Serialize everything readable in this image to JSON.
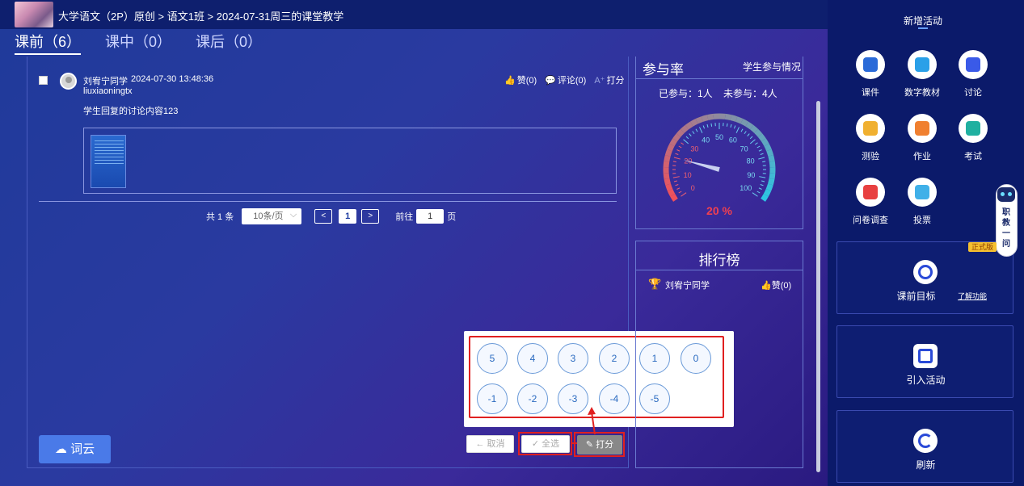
{
  "breadcrumb": {
    "text": "大学语文（2P）原创 > 语文1班 > 2024-07-31周三的课堂教学"
  },
  "tabs": [
    {
      "label": "课前（6）"
    },
    {
      "label": "课中（0）"
    },
    {
      "label": "课后（0）"
    }
  ],
  "post": {
    "name": "刘宥宁同学",
    "time": "2024-07-30 13:48:36",
    "userid": "liuxiaoningtx",
    "content": "学生回复的讨论内容123",
    "like": "赞(0)",
    "comment": "评论(0)",
    "score": "打分"
  },
  "pager": {
    "total": "共 1 条",
    "pagesize": "10条/页",
    "prev": "<",
    "current": "1",
    "next": ">",
    "goto_label": "前往",
    "goto_value": "1",
    "goto_unit": "页"
  },
  "wordcloud_label": "词云",
  "score_popup": {
    "row1": [
      "5",
      "4",
      "3",
      "2",
      "1",
      "0"
    ],
    "row2": [
      "-1",
      "-2",
      "-3",
      "-4",
      "-5"
    ]
  },
  "bottom_buttons": {
    "cancel": "取消",
    "select_all": "全选",
    "score": "打分"
  },
  "participation": {
    "title": "参与率",
    "link": "学生参与情况",
    "stats": "已参与：1人    未参与：4人",
    "percent_label": "20 %",
    "percent": 20,
    "ticks": [
      "0",
      "10",
      "20",
      "30",
      "40",
      "50",
      "60",
      "70",
      "80",
      "90",
      "100"
    ]
  },
  "ranking": {
    "title": "排行榜",
    "items": [
      {
        "name": "刘宥宁同学",
        "likes": "赞(0)"
      }
    ]
  },
  "sidebar": {
    "title": "新增活动",
    "activities": [
      {
        "label": "课件",
        "color": "#2a6ad8"
      },
      {
        "label": "数字教材",
        "color": "#2aa0e8"
      },
      {
        "label": "讨论",
        "color": "#3a5ae8"
      },
      {
        "label": "测验",
        "color": "#f0b030"
      },
      {
        "label": "作业",
        "color": "#f08030"
      },
      {
        "label": "考试",
        "color": "#20b0a0"
      },
      {
        "label": "问卷调查",
        "color": "#e84040"
      },
      {
        "label": "投票",
        "color": "#40b0e8"
      }
    ],
    "cards": [
      {
        "label": "课前目标",
        "extra": "了解功能"
      },
      {
        "label": "引入活动"
      },
      {
        "label": "刷新"
      }
    ],
    "assistant_text": "职教一问",
    "badge": "正式版"
  }
}
